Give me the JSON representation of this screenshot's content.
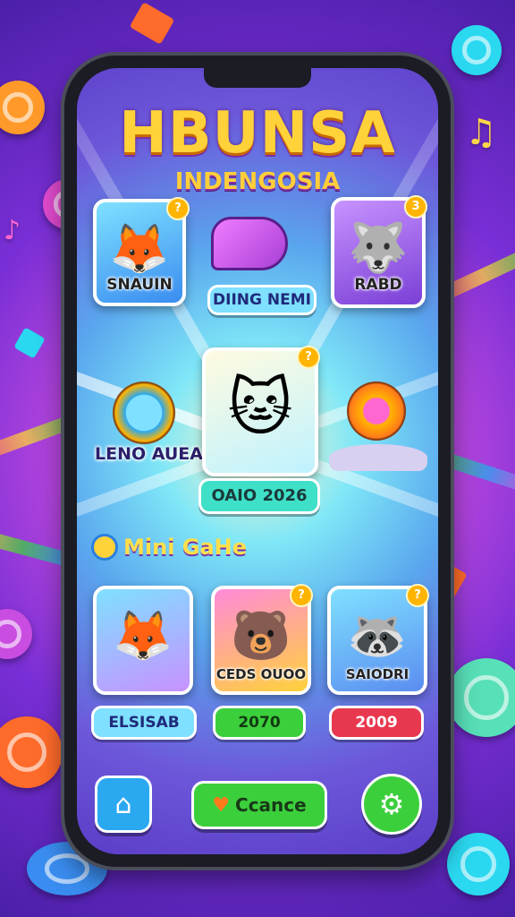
{
  "app": {
    "title": "HBUNSA",
    "subtitle": "INDENGOSIA"
  },
  "featured": {
    "left_card_label": "SNAUIN",
    "center_top_pill": "DIING NEMI",
    "right_card_label": "RABD",
    "left_float_label": "LENO AUEA",
    "center_card_pill": "OAIO 2026",
    "badges": [
      "?",
      "3",
      "?"
    ]
  },
  "mini": {
    "section_title": "Mini GaHe",
    "cards": [
      {
        "label": "",
        "pill": "ELSISAB"
      },
      {
        "label": "CEDS OUOO",
        "pill": "2070"
      },
      {
        "label": "SAIODRI",
        "pill": "2009"
      }
    ]
  },
  "bottom_nav": {
    "home_icon": "home-icon",
    "center_button_label": "Ccance",
    "settings_icon": "gear-icon"
  },
  "colors": {
    "title": "#ffd23a",
    "green_button": "#3ccf3c",
    "blue_button": "#2aa8f0",
    "red_pill": "#e8384f"
  }
}
